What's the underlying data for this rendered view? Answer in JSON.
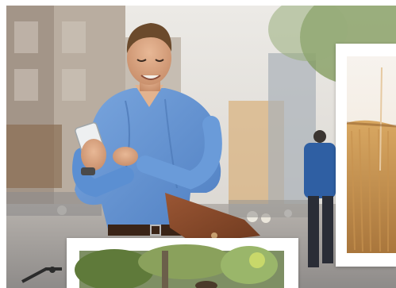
{
  "hero": {
    "image_icon": "hero-photo-man-with-phone-icon"
  },
  "gallery": {
    "cards": [
      {
        "icon": "wheat-field-photo-icon"
      },
      {
        "icon": "garden-trees-photo-icon"
      }
    ]
  },
  "colors": {
    "shirt": "#5b8fd2",
    "bag": "#8a4a2a",
    "sky": "#e4e1dc",
    "field": "#c99a52",
    "foliage": "#5f7a3a"
  }
}
